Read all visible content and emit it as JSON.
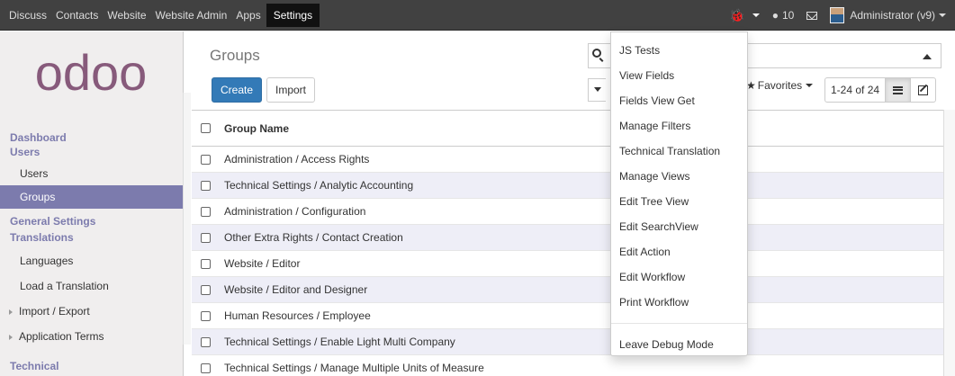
{
  "topbar": {
    "menu": [
      "Discuss",
      "Contacts",
      "Website",
      "Website Admin",
      "Apps",
      "Settings"
    ],
    "debug_icon": "bug-icon",
    "messages_count": "10",
    "user": "Administrator (v9)"
  },
  "sidebar": {
    "logo": "odoo",
    "sections": [
      {
        "title": "Dashboard"
      },
      {
        "title": "Users",
        "items": [
          "Users",
          "Groups"
        ]
      },
      {
        "title": "General Settings"
      },
      {
        "title": "Translations",
        "items": [
          "Languages",
          "Load a Translation",
          "Import / Export",
          "Application Terms"
        ]
      },
      {
        "title": "Technical"
      }
    ],
    "active_item": "Groups"
  },
  "control_panel": {
    "breadcrumb": "Groups",
    "create_label": "Create",
    "import_label": "Import",
    "favorites_label": "Favorites",
    "pager": "1-24 of 24"
  },
  "table": {
    "header": "Group Name",
    "rows": [
      "Administration / Access Rights",
      "Technical Settings / Analytic Accounting",
      "Administration / Configuration",
      "Other Extra Rights / Contact Creation",
      "Website / Editor",
      "Website / Editor and Designer",
      "Human Resources / Employee",
      "Technical Settings / Enable Light Multi Company",
      "Technical Settings / Manage Multiple Units of Measure"
    ]
  },
  "debug_menu": {
    "items": [
      "JS Tests",
      "View Fields",
      "Fields View Get",
      "Manage Filters",
      "Technical Translation",
      "Manage Views",
      "Edit Tree View",
      "Edit SearchView",
      "Edit Action",
      "Edit Workflow",
      "Print Workflow"
    ],
    "leave": "Leave Debug Mode"
  },
  "colors": {
    "topbar": "#414141",
    "accent": "#7c7bad",
    "primary_button": "#337ab7"
  }
}
